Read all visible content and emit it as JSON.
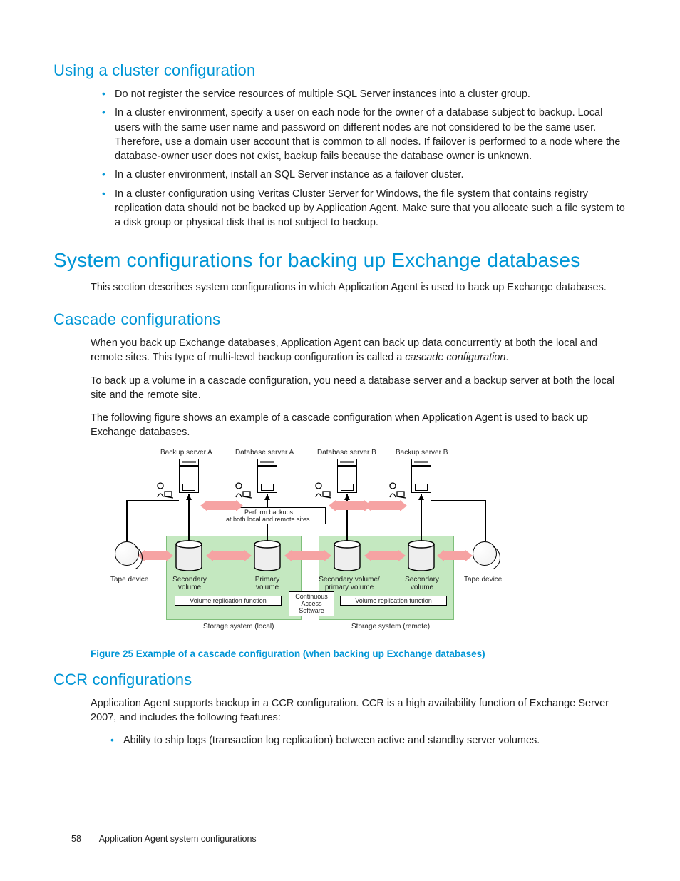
{
  "sec1": {
    "title": "Using a cluster configuration",
    "bullets": [
      "Do not register the service resources of multiple SQL Server instances into a cluster group.",
      "In a cluster environment, specify a user on each node for the owner of a database subject to backup. Local users with the same user name and password on different nodes are not considered to be the same user. Therefore, use a domain user account that is common to all nodes. If failover is performed to a node where the database-owner user does not exist, backup fails because the database owner is unknown.",
      "In a cluster environment, install an SQL Server instance as a failover cluster.",
      "In a cluster configuration using Veritas Cluster Server for Windows, the file system that contains registry replication data should not be backed up by Application Agent. Make sure that you allocate such a file system to a disk group or physical disk that is not subject to backup."
    ]
  },
  "sec2": {
    "title": "System configurations for backing up Exchange databases",
    "intro": "This section describes system configurations in which Application Agent is used to back up Exchange databases."
  },
  "sec3": {
    "title": "Cascade configurations",
    "p1a": "When you back up Exchange databases, Application Agent can back up data concurrently at both the local and remote sites. This type of multi-level backup configuration is called a ",
    "p1em": "cascade configuration",
    "p1b": ".",
    "p2": "To back up a volume in a cascade configuration, you need a database server and a backup server at both the local site and the remote site.",
    "p3": "The following figure shows an example of a cascade configuration when Application Agent is used to back up Exchange databases."
  },
  "figure": {
    "caption": "Figure 25 Example of a cascade configuration (when backing up Exchange databases)",
    "labels": {
      "bsA": "Backup server A",
      "dsA": "Database server A",
      "dsB": "Database server B",
      "bsB": "Backup server B",
      "perform": "Perform backups\nat both local and remote sites.",
      "tapeL": "Tape device",
      "tapeR": "Tape device",
      "secVol": "Secondary\nvolume",
      "priVol": "Primary\nvolume",
      "secPriVol": "Secondary volume/\nprimary volume",
      "secVol2": "Secondary\nvolume",
      "vrf": "Volume replication function",
      "cas": "Continuous\nAccess\nSoftware",
      "ssl": "Storage system (local)",
      "ssr": "Storage system (remote)"
    }
  },
  "sec4": {
    "title": "CCR configurations",
    "p1": "Application Agent supports backup in a CCR configuration. CCR is a high availability function of Exchange Server 2007, and includes the following features:",
    "bullets": [
      "Ability to ship logs (transaction log replication) between active and standby server volumes."
    ]
  },
  "footer": {
    "page": "58",
    "title": "Application Agent system configurations"
  }
}
